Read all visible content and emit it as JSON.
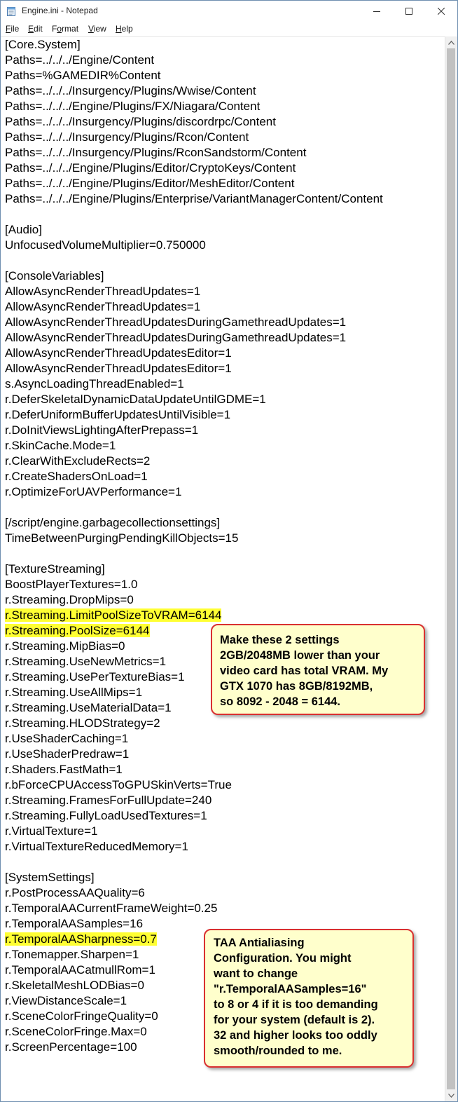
{
  "window": {
    "title": "Engine.ini - Notepad",
    "icon": "notepad-icon"
  },
  "menu": [
    {
      "label": "File",
      "key": "F",
      "rest": "ile"
    },
    {
      "label": "Edit",
      "key": "E",
      "rest": "dit"
    },
    {
      "label": "Format",
      "key": "o",
      "pre": "F",
      "rest": "rmat"
    },
    {
      "label": "View",
      "key": "V",
      "rest": "iew"
    },
    {
      "label": "Help",
      "key": "H",
      "rest": "elp"
    }
  ],
  "highlight_color": "#ffff33",
  "callout_border_color": "#d93030",
  "callout_fill_color": "#ffffcc",
  "lines": [
    "[Core.System]",
    "Paths=../../../Engine/Content",
    "Paths=%GAMEDIR%Content",
    "Paths=../../../Insurgency/Plugins/Wwise/Content",
    "Paths=../../../Engine/Plugins/FX/Niagara/Content",
    "Paths=../../../Insurgency/Plugins/discordrpc/Content",
    "Paths=../../../Insurgency/Plugins/Rcon/Content",
    "Paths=../../../Insurgency/Plugins/RconSandstorm/Content",
    "Paths=../../../Engine/Plugins/Editor/CryptoKeys/Content",
    "Paths=../../../Engine/Plugins/Editor/MeshEditor/Content",
    "Paths=../../../Engine/Plugins/Enterprise/VariantManagerContent/Content",
    "",
    "[Audio]",
    "UnfocusedVolumeMultiplier=0.750000",
    "",
    "[ConsoleVariables]",
    "AllowAsyncRenderThreadUpdates=1",
    "AllowAsyncRenderThreadUpdates=1",
    "AllowAsyncRenderThreadUpdatesDuringGamethreadUpdates=1",
    "AllowAsyncRenderThreadUpdatesDuringGamethreadUpdates=1",
    "AllowAsyncRenderThreadUpdatesEditor=1",
    "AllowAsyncRenderThreadUpdatesEditor=1",
    "s.AsyncLoadingThreadEnabled=1",
    "r.DeferSkeletalDynamicDataUpdateUntilGDME=1",
    "r.DeferUniformBufferUpdatesUntilVisible=1",
    "r.DoInitViewsLightingAfterPrepass=1",
    "r.SkinCache.Mode=1",
    "r.ClearWithExcludeRects=2",
    "r.CreateShadersOnLoad=1",
    "r.OptimizeForUAVPerformance=1",
    "",
    "[/script/engine.garbagecollectionsettings]",
    "TimeBetweenPurgingPendingKillObjects=15",
    "",
    "[TextureStreaming]",
    "BoostPlayerTextures=1.0",
    "r.Streaming.DropMips=0",
    "r.Streaming.LimitPoolSizeToVRAM=6144",
    "r.Streaming.PoolSize=6144",
    "r.Streaming.MipBias=0",
    "r.Streaming.UseNewMetrics=1",
    "r.Streaming.UsePerTextureBias=1",
    "r.Streaming.UseAllMips=1",
    "r.Streaming.UseMaterialData=1",
    "r.Streaming.HLODStrategy=2",
    "r.UseShaderCaching=1",
    "r.UseShaderPredraw=1",
    "r.Shaders.FastMath=1",
    "r.bForceCPUAccessToGPUSkinVerts=True",
    "r.Streaming.FramesForFullUpdate=240",
    "r.Streaming.FullyLoadUsedTextures=1",
    "r.VirtualTexture=1",
    "r.VirtualTextureReducedMemory=1",
    "",
    "[SystemSettings]",
    "r.PostProcessAAQuality=6",
    "r.TemporalAACurrentFrameWeight=0.25",
    "r.TemporalAASamples=16",
    "r.TemporalAASharpness=0.7",
    "r.Tonemapper.Sharpen=1",
    "r.TemporalAACatmullRom=1",
    "r.SkeletalMeshLODBias=0",
    "r.ViewDistanceScale=1",
    "r.SceneColorFringeQuality=0",
    "r.SceneColorFringe.Max=0",
    "r.ScreenPercentage=100"
  ],
  "highlighted_lines": [
    37,
    38,
    58
  ],
  "callouts": {
    "vram": [
      "Make these 2 settings",
      "2GB/2048MB lower than your",
      "video card has total VRAM. My",
      "GTX 1070 has 8GB/8192MB,",
      "so 8092 - 2048 = 6144."
    ],
    "taa": [
      "TAA Antialiasing",
      "Configuration. You might",
      "want to change",
      "\"r.TemporalAASamples=16\"",
      "to 8 or 4 if it is too demanding",
      "for your system (default is 2).",
      "32 and higher looks too oddly",
      "smooth/rounded to me."
    ]
  }
}
